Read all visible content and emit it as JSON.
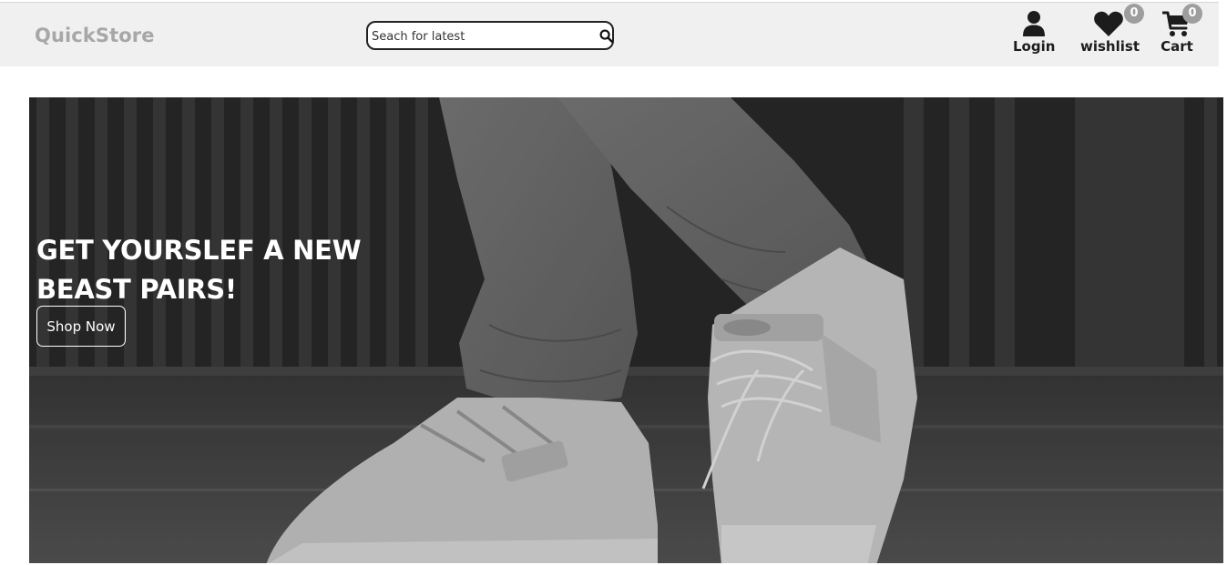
{
  "brand": {
    "name": "QuickStore"
  },
  "search": {
    "placeholder": "Seach for latest",
    "value": ""
  },
  "nav": {
    "login_label": "Login",
    "wishlist_label": "wishlist",
    "wishlist_count": "0",
    "cart_label": "Cart",
    "cart_count": "0"
  },
  "hero": {
    "title": "GET YOURSLEF A NEW BEAST PAIRS!",
    "button_label": "Shop Now",
    "image_subject": "person wearing white high-top sneakers and grey jeans, grayscale"
  },
  "colors": {
    "navbar_bg": "#f0f0f0",
    "brand": "#a7a7a7",
    "badge": "#9e9e9e",
    "text_dark": "#1c1c1c",
    "hero_text": "#ffffff"
  }
}
